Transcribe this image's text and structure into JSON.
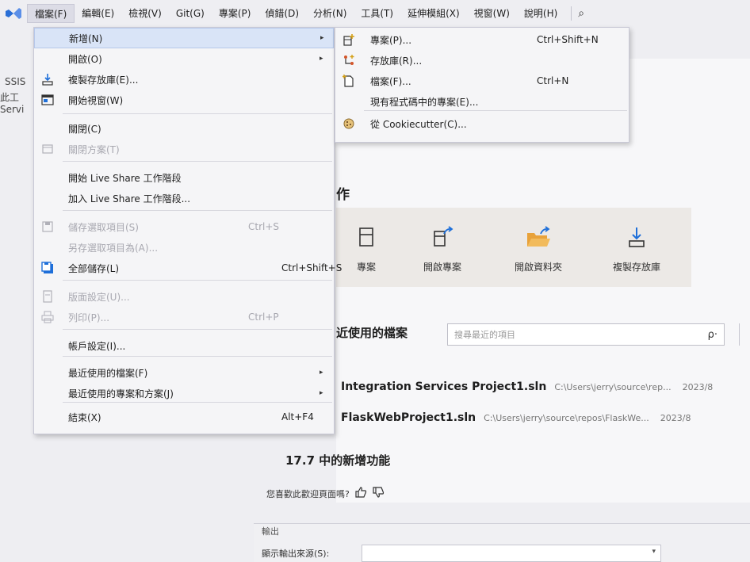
{
  "menubar": {
    "items": [
      "檔案(F)",
      "編輯(E)",
      "檢視(V)",
      "Git(G)",
      "專案(P)",
      "偵錯(D)",
      "分析(N)",
      "工具(T)",
      "延伸模組(X)",
      "視窗(W)",
      "說明(H)"
    ],
    "search_icon": "search-icon"
  },
  "left_strip": {
    "line1": "SSIS",
    "line2": "此工",
    "line3": "Servi"
  },
  "file_menu": {
    "items": [
      {
        "label": "新增(N)",
        "key": "",
        "arrow": "▸",
        "icon": "",
        "state": "highlight"
      },
      {
        "label": "開啟(O)",
        "key": "",
        "arrow": "▸",
        "icon": "",
        "state": "normal"
      },
      {
        "label": "複製存放庫(E)...",
        "key": "",
        "arrow": "",
        "icon": "clone-repo-icon",
        "state": "normal"
      },
      {
        "label": "開始視窗(W)",
        "key": "",
        "arrow": "",
        "icon": "start-window-icon",
        "state": "normal"
      },
      {
        "label": "關閉(C)",
        "key": "",
        "arrow": "",
        "icon": "",
        "state": "normal"
      },
      {
        "label": "關閉方案(T)",
        "key": "",
        "arrow": "",
        "icon": "close-solution-icon",
        "state": "disabled"
      },
      {
        "label": "開始 Live Share 工作階段",
        "key": "",
        "arrow": "",
        "icon": "",
        "state": "normal"
      },
      {
        "label": "加入 Live Share 工作階段...",
        "key": "",
        "arrow": "",
        "icon": "",
        "state": "normal"
      },
      {
        "label": "儲存選取項目(S)",
        "key": "Ctrl+S",
        "arrow": "",
        "icon": "save-icon",
        "state": "disabled"
      },
      {
        "label": "另存選取項目為(A)...",
        "key": "",
        "arrow": "",
        "icon": "",
        "state": "disabled"
      },
      {
        "label": "全部儲存(L)",
        "key": "Ctrl+Shift+S",
        "arrow": "",
        "icon": "save-all-icon",
        "state": "normal"
      },
      {
        "label": "版面設定(U)...",
        "key": "",
        "arrow": "",
        "icon": "page-setup-icon",
        "state": "disabled"
      },
      {
        "label": "列印(P)...",
        "key": "Ctrl+P",
        "arrow": "",
        "icon": "print-icon",
        "state": "disabled"
      },
      {
        "label": "帳戶設定(I)...",
        "key": "",
        "arrow": "",
        "icon": "",
        "state": "normal"
      },
      {
        "label": "最近使用的檔案(F)",
        "key": "",
        "arrow": "▸",
        "icon": "",
        "state": "normal"
      },
      {
        "label": "最近使用的專案和方案(J)",
        "key": "",
        "arrow": "▸",
        "icon": "",
        "state": "normal"
      },
      {
        "label": "結束(X)",
        "key": "Alt+F4",
        "arrow": "",
        "icon": "",
        "state": "normal"
      }
    ]
  },
  "new_submenu": {
    "items": [
      {
        "label": "專案(P)...",
        "key": "Ctrl+Shift+N",
        "icon": "new-project-icon"
      },
      {
        "label": "存放庫(R)...",
        "key": "",
        "icon": "repository-icon"
      },
      {
        "label": "檔案(F)...",
        "key": "Ctrl+N",
        "icon": "new-file-icon"
      },
      {
        "label": "現有程式碼中的專案(E)...",
        "key": "",
        "icon": ""
      },
      {
        "label": "從 Cookiecutter(C)...",
        "key": "",
        "icon": "cookiecutter-icon"
      }
    ]
  },
  "start_window": {
    "heading_fragment": "作",
    "actions": [
      {
        "label": "專案",
        "icon": "new-project-icon"
      },
      {
        "label": "開啟專案",
        "icon": "open-project-icon"
      },
      {
        "label": "開啟資料夾",
        "icon": "open-folder-icon"
      },
      {
        "label": "複製存放庫",
        "icon": "clone-repository-icon"
      }
    ],
    "recent_heading": "近使用的檔案",
    "search_placeholder": "搜尋最近的項目",
    "search_icon_glyph": "ρ·",
    "recent": [
      {
        "name": "Integration Services Project1.sln",
        "path": "C:\\Users\\jerry\\source\\rep...",
        "date": "2023/8"
      },
      {
        "name": "FlaskWebProject1.sln",
        "path": "C:\\Users\\jerry\\source\\repos\\FlaskWe...",
        "date": "2023/8"
      }
    ],
    "whats_new": "17.7 中的新增功能",
    "feedback": "您喜歡此歡迎頁面嗎?"
  },
  "output_pane": {
    "title": "輸出",
    "source_label": "顯示輸出來源(S):"
  },
  "colors": {
    "vs_purple": "#68217a",
    "highlight": "#d9e4f7",
    "accent_blue": "#1e6fd9",
    "folder_orange": "#e8a23a"
  }
}
